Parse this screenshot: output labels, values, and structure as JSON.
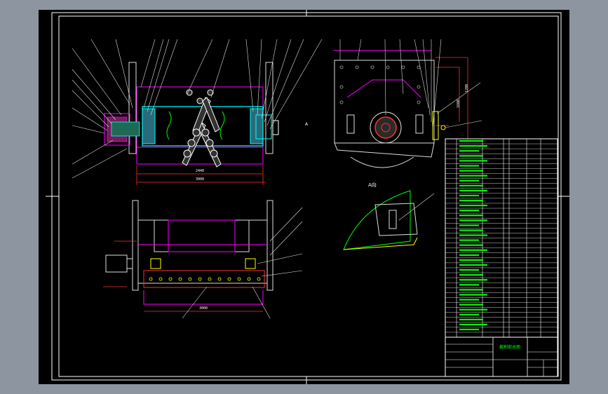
{
  "drawing": {
    "view_label_a": "A向",
    "dimension_inner": "2440",
    "dimension_total": "3000",
    "dimension_bottom": "3000",
    "dimension_right_1": "1200",
    "dimension_right_2": "1600",
    "colors": {
      "background": "#000000",
      "border": "#ffffff",
      "outline": "#ffffff",
      "structure": "#d6d6d6",
      "magenta": "#ff00ff",
      "green": "#00ff00",
      "red": "#ff3030",
      "cyan": "#00ffff",
      "yellow": "#ffff00"
    }
  },
  "title_block": {
    "drawing_title": "截割部总图"
  }
}
